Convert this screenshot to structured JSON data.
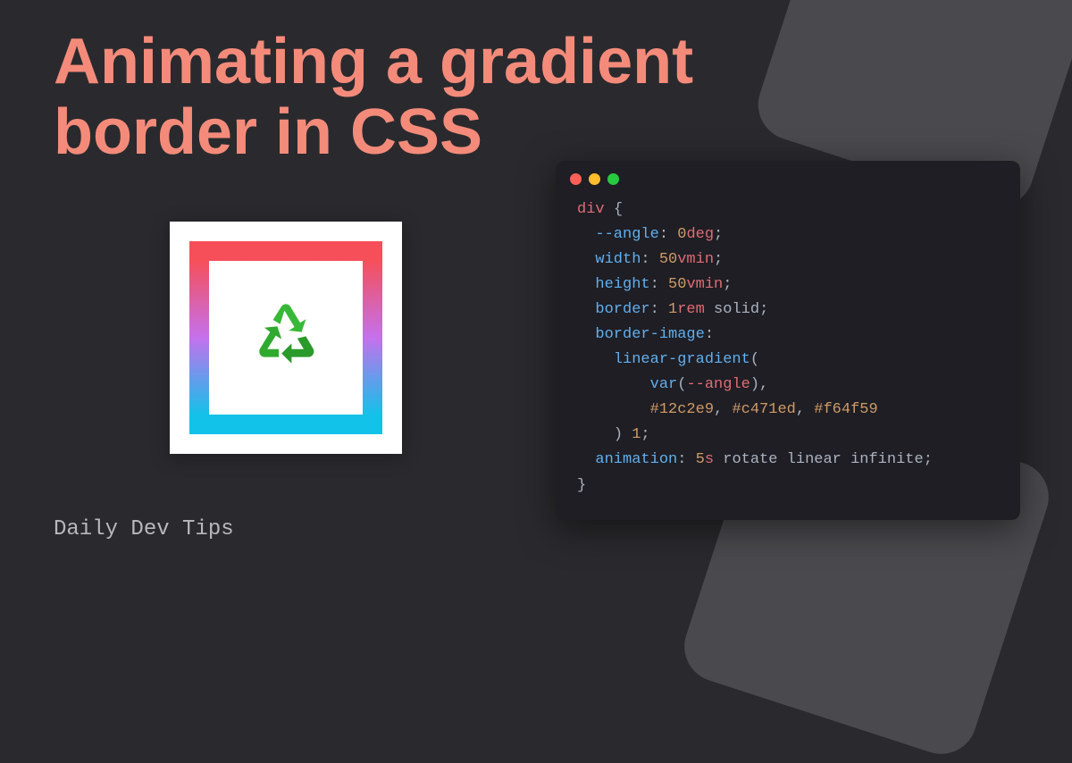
{
  "title": "Animating a gradient border in CSS",
  "footer": "Daily Dev Tips",
  "demo": {
    "icon_name": "recycle",
    "gradient_colors": [
      "#f64f59",
      "#c471ed",
      "#12c2e9"
    ]
  },
  "code": {
    "selector": "div",
    "lines": [
      {
        "type": "decl",
        "prop": "--angle",
        "value": "0deg"
      },
      {
        "type": "decl",
        "prop": "width",
        "value": "50vmin"
      },
      {
        "type": "decl",
        "prop": "height",
        "value": "50vmin"
      },
      {
        "type": "decl",
        "prop": "border",
        "value": "1rem solid"
      },
      {
        "type": "prop_only",
        "prop": "border-image"
      },
      {
        "type": "raw",
        "text": "    linear-gradient("
      },
      {
        "type": "raw",
        "text": "        var(--angle),"
      },
      {
        "type": "raw",
        "text": "        #12c2e9, #c471ed, #f64f59"
      },
      {
        "type": "raw",
        "text": "    ) 1;"
      },
      {
        "type": "decl",
        "prop": "animation",
        "value": "5s rotate linear infinite"
      }
    ]
  }
}
